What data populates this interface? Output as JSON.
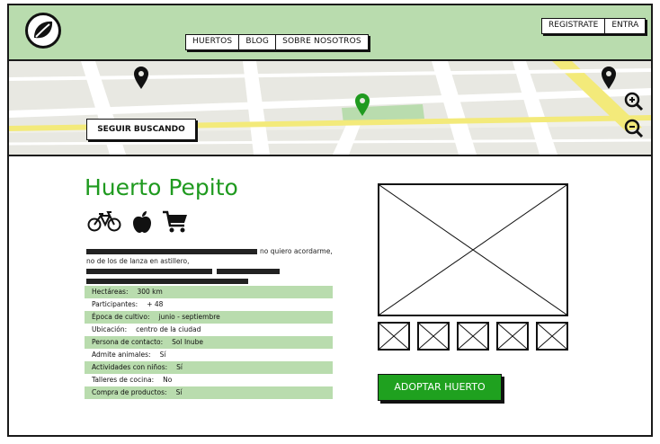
{
  "nav": {
    "items": [
      "HUERTOS",
      "BLOG",
      "SOBRE NOSOTROS"
    ]
  },
  "auth": {
    "register": "REGISTRATE",
    "login": "ENTRA"
  },
  "map": {
    "button": "SEGUIR BUSCANDO"
  },
  "garden": {
    "title": "Huerto Pepito",
    "description": "no quiero acordarme, no de los de lanza en astillero,",
    "details": [
      {
        "label": "Hectáreas:",
        "value": "300 km"
      },
      {
        "label": "Participantes:",
        "value": "+ 48"
      },
      {
        "label": "Época de cultivo:",
        "value": "junio - septiembre"
      },
      {
        "label": "Ubicación:",
        "value": "centro de la ciudad"
      },
      {
        "label": "Persona de contacto:",
        "value": "Sol Inube"
      },
      {
        "label": "Admite animales:",
        "value": "Sí"
      },
      {
        "label": "Actividades con niños:",
        "value": "Sí"
      },
      {
        "label": "Talleres de cocina:",
        "value": "No"
      },
      {
        "label": "Compra de productos:",
        "value": "Sí"
      }
    ],
    "adopt_button": "ADOPTAR HUERTO"
  },
  "icons": {
    "logo": "leaf-icon",
    "features": [
      "bicycle-icon",
      "apple-icon",
      "cart-icon"
    ],
    "map_pins": [
      "map-pin-icon",
      "map-pin-icon",
      "map-pin-selected-icon"
    ],
    "zoom": [
      "zoom-in-icon",
      "zoom-out-icon"
    ]
  },
  "colors": {
    "header_bg": "#b9dcae",
    "accent_green": "#1f9a1f",
    "button_green": "#1fa11f",
    "map_highlight": "#f3ea7a"
  }
}
